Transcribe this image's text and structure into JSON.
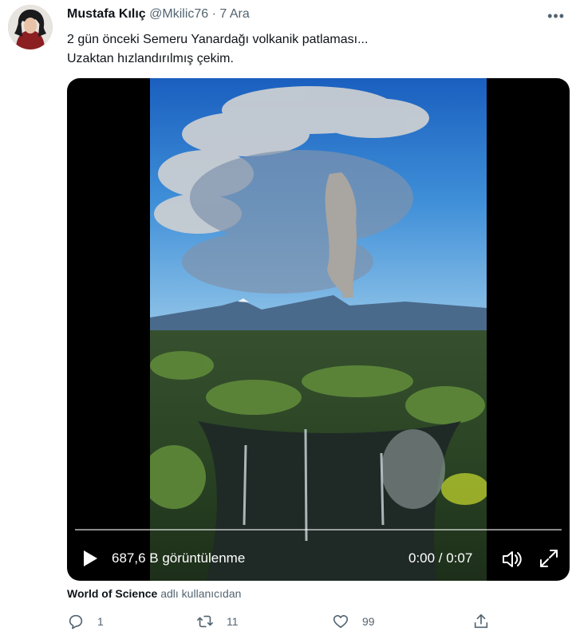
{
  "tweet": {
    "author_name": "Mustafa Kılıç",
    "handle": "@Mkilic76",
    "separator": "·",
    "date": "7 Ara",
    "more": "•••",
    "text_line1": "2 gün önceki Semeru Yanardağı volkanik patlaması...",
    "text_line2": "Uzaktan hızlandırılmış çekim."
  },
  "video": {
    "views": "687,6 B görüntülenme",
    "time": "0:00 / 0:07"
  },
  "attribution": {
    "source_name": "World of Science",
    "suffix": "adlı kullanıcıdan"
  },
  "actions": {
    "reply_count": "1",
    "retweet_count": "11",
    "like_count": "99"
  },
  "icons": [
    "more-icon",
    "play-icon",
    "volume-icon",
    "fullscreen-icon",
    "reply-icon",
    "retweet-icon",
    "like-icon",
    "share-icon"
  ]
}
